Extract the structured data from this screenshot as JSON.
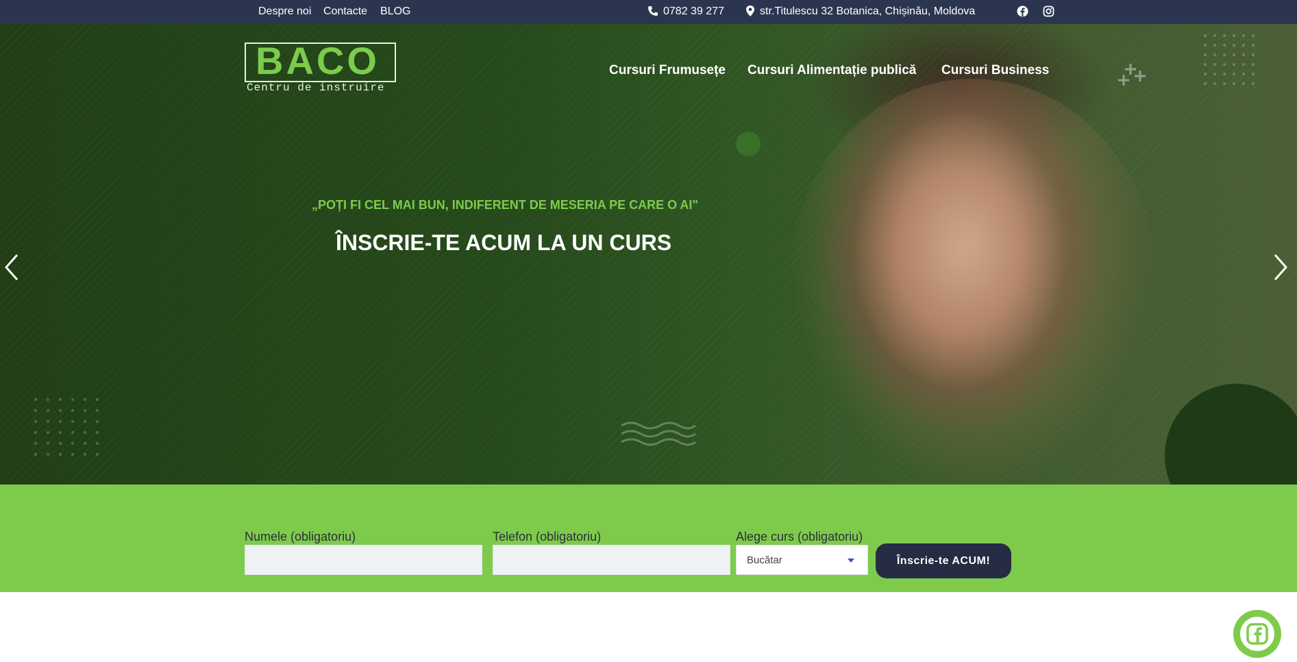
{
  "topbar": {
    "links": [
      "Despre noi",
      "Contacte",
      "BLOG"
    ],
    "phone": "0782 39 277",
    "address": "str.Titulescu 32 Botanica, Chișinău, Moldova",
    "social_icons": [
      "facebook-icon",
      "instagram-icon"
    ]
  },
  "logo": {
    "name": "BACO",
    "tagline": "Centru de instruire"
  },
  "nav": {
    "items": [
      "Cursuri Frumusețe",
      "Cursuri Alimentație publică",
      "Cursuri Business"
    ]
  },
  "hero": {
    "quote": "„POȚI FI CEL MAI BUN, INDIFERENT DE MESERIA PE CARE O AI\"",
    "title": "ÎNSCRIE-TE ACUM LA UN CURS",
    "prev_icon": "chevron-left-icon",
    "next_icon": "chevron-right-icon"
  },
  "form": {
    "name_label": "Numele (obligatoriu)",
    "name_value": "",
    "phone_label": "Telefon (obligatoriu)",
    "phone_value": "",
    "course_label": "Alege curs (obligatoriu)",
    "course_selected": "Bucătar",
    "submit_label": "Înscrie-te ACUM!"
  },
  "floating": {
    "icon": "facebook-icon"
  },
  "colors": {
    "topbar": "#2c3550",
    "accent_green": "#7ecb4c",
    "button_dark": "#252c43"
  }
}
